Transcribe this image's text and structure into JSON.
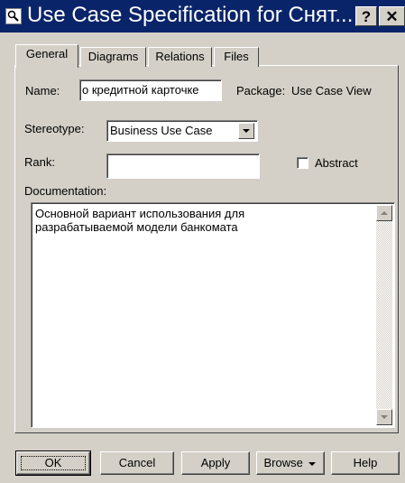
{
  "window": {
    "title": "Use Case Specification for Снят...",
    "help_btn": "?",
    "close_btn": "✕"
  },
  "tabs": [
    {
      "label": "General",
      "active": true
    },
    {
      "label": "Diagrams",
      "active": false
    },
    {
      "label": "Relations",
      "active": false
    },
    {
      "label": "Files",
      "active": false
    }
  ],
  "form": {
    "name_label": "Name:",
    "name_value": "о кредитной карточке",
    "package_label": "Package:",
    "package_value": "Use Case View",
    "stereotype_label": "Stereotype:",
    "stereotype_value": "Business Use Case",
    "rank_label": "Rank:",
    "rank_value": "",
    "abstract_label": "Abstract",
    "abstract_checked": false,
    "documentation_label": "Documentation:",
    "documentation_text": "Основной вариант использования для\nразрабатываемой модели банкомата"
  },
  "buttons": {
    "ok": "OK",
    "cancel": "Cancel",
    "apply": "Apply",
    "browse": "Browse",
    "help": "Help"
  },
  "colors": {
    "titlebar": "#0a246a",
    "face": "#d4d0c8"
  }
}
